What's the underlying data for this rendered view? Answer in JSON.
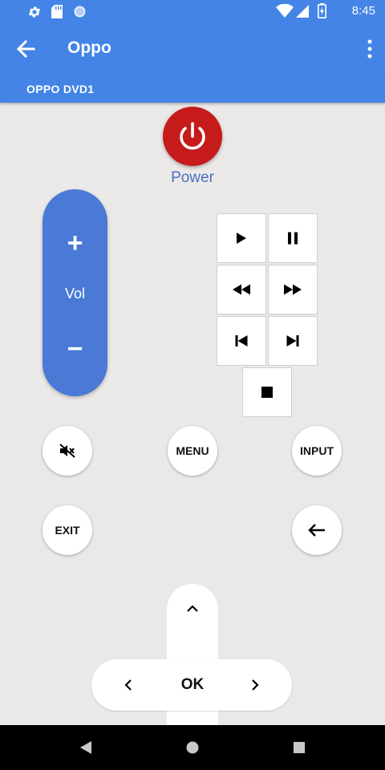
{
  "status_bar": {
    "time": "8:45",
    "icons": [
      "settings-icon",
      "sd-card-icon",
      "circle-icon",
      "wifi-icon",
      "signal-icon",
      "battery-charging-icon"
    ]
  },
  "toolbar": {
    "title": "Oppo",
    "back_icon": "arrow-back-icon",
    "menu_icon": "more-vert-icon"
  },
  "device": {
    "name": "OPPO DVD1"
  },
  "power": {
    "label": "Power",
    "color": "#c61b1b"
  },
  "volume": {
    "up": "+",
    "label": "Vol",
    "down": "−",
    "color": "#4a79d6"
  },
  "transport": [
    "play-icon",
    "pause-icon",
    "rewind-icon",
    "fast-forward-icon",
    "skip-previous-icon",
    "skip-next-icon",
    "stop-icon"
  ],
  "buttons": {
    "mute_icon": "volume-off-icon",
    "menu": "MENU",
    "input": "INPUT",
    "exit": "EXIT",
    "back_icon": "arrow-left-icon"
  },
  "dpad": {
    "ok": "OK"
  },
  "nav": [
    "back-triangle-icon",
    "home-circle-icon",
    "recents-square-icon"
  ],
  "colors": {
    "accent": "#4384e6",
    "background": "#ebe9e8"
  }
}
